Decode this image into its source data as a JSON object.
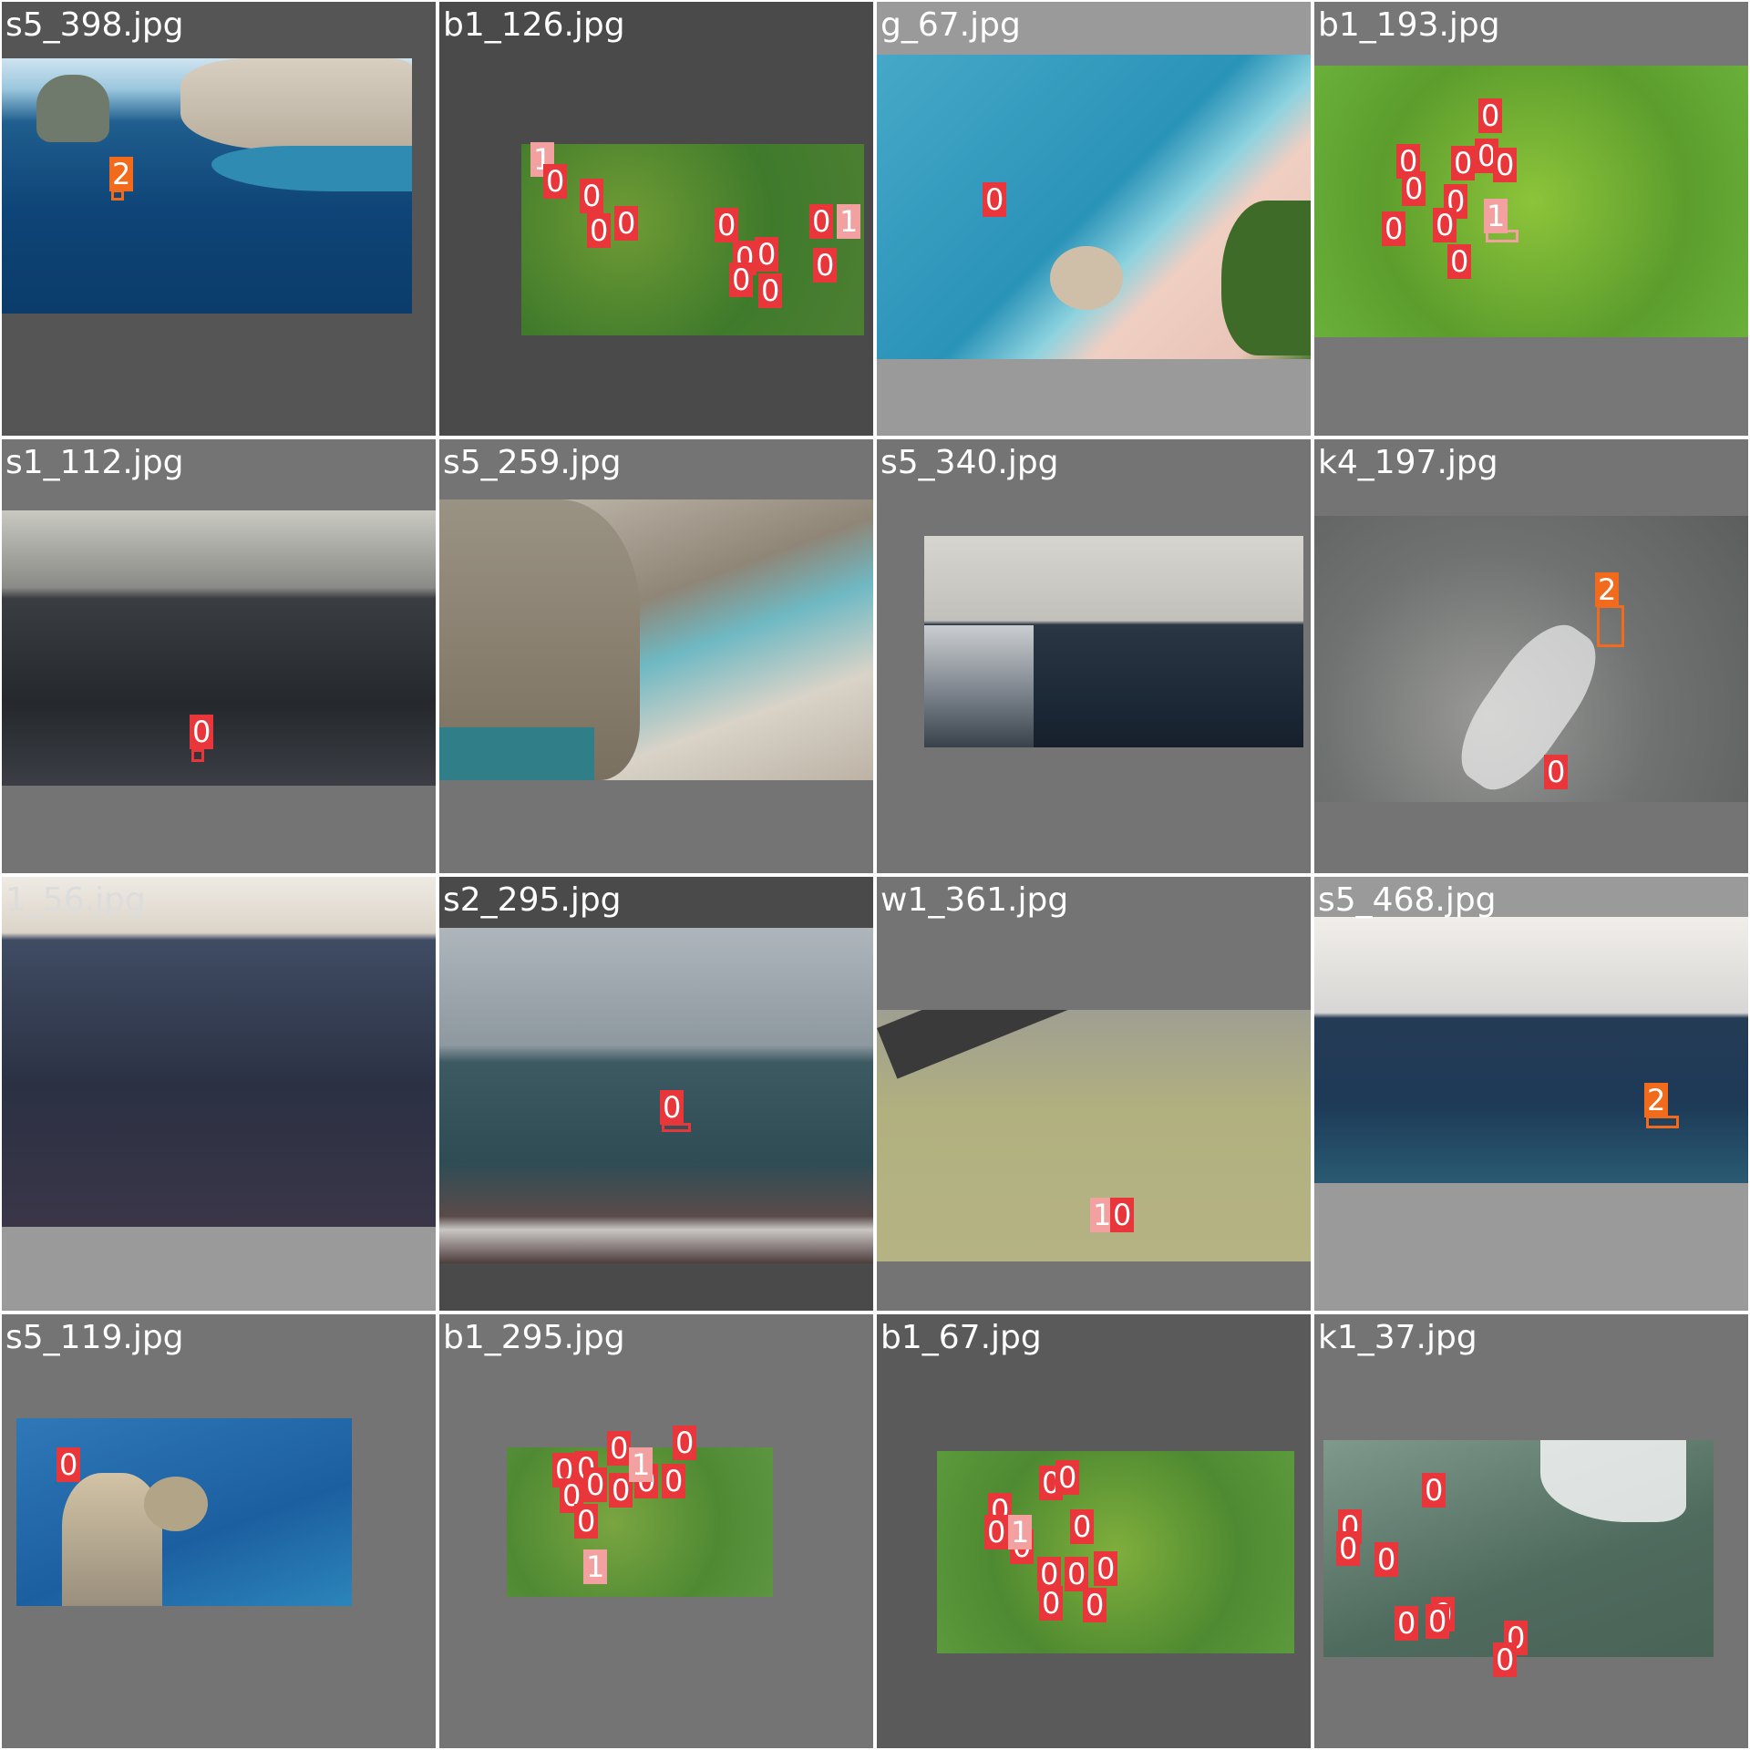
{
  "mosaic": {
    "tiles": [
      {
        "filename": "s5_398.jpg",
        "labels": [
          "2"
        ]
      },
      {
        "filename": "b1_126.jpg",
        "labels": [
          "1",
          "0",
          "0",
          "0",
          "0",
          "0",
          "0",
          "0",
          "0",
          "0",
          "0",
          "1",
          "0"
        ]
      },
      {
        "filename": "g_67.jpg",
        "labels": [
          "0"
        ]
      },
      {
        "filename": "b1_193.jpg",
        "labels": [
          "0",
          "0",
          "0",
          "0",
          "0",
          "0",
          "0",
          "0",
          "0",
          "1",
          "0"
        ]
      },
      {
        "filename": "s1_112.jpg",
        "labels": [
          "0"
        ]
      },
      {
        "filename": "s5_259.jpg",
        "labels": []
      },
      {
        "filename": "s5_340.jpg",
        "labels": []
      },
      {
        "filename": "k4_197.jpg",
        "labels": [
          "2",
          "0"
        ]
      },
      {
        "filename": "1_56.jpg",
        "labels": []
      },
      {
        "filename": "s2_295.jpg",
        "labels": [
          "0"
        ]
      },
      {
        "filename": "w1_361.jpg",
        "labels": [
          "1",
          "0"
        ]
      },
      {
        "filename": "s5_468.jpg",
        "labels": [
          "2"
        ]
      },
      {
        "filename": "s5_119.jpg",
        "labels": [
          "0"
        ]
      },
      {
        "filename": "b1_295.jpg",
        "labels": [
          "0",
          "0",
          "0",
          "0",
          "0",
          "0",
          "0",
          "0",
          "1",
          "0",
          "0",
          "1"
        ]
      },
      {
        "filename": "b1_67.jpg",
        "labels": [
          "0",
          "0",
          "0",
          "1",
          "0",
          "0",
          "0",
          "0",
          "0",
          "0",
          "0",
          "0"
        ]
      },
      {
        "filename": "k1_37.jpg",
        "labels": [
          "0",
          "0",
          "0",
          "0",
          "0",
          "0",
          "0",
          "0",
          "0"
        ]
      }
    ]
  },
  "colors": {
    "class_0": "#e8363a",
    "class_1": "#f2a0a0",
    "class_2": "#f26b1d"
  }
}
